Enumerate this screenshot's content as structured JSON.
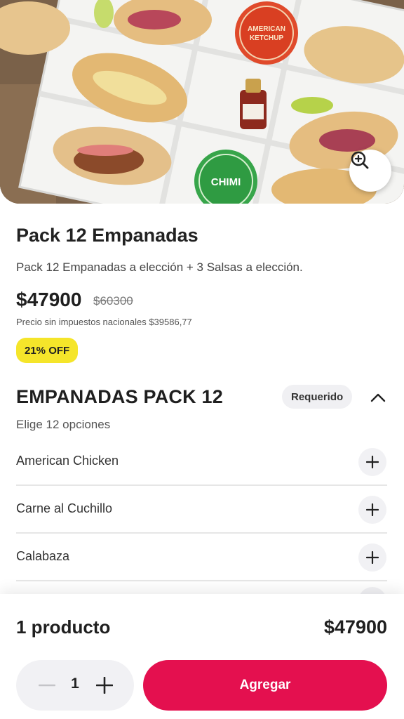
{
  "hero": {
    "image_alt": "Caja con 12 empanadas y salsas",
    "sauce_ketchup": "AMERICAN KETCHUP",
    "sauce_chimi": "CHIMI",
    "zoom_icon": "zoom-in-icon"
  },
  "product": {
    "title": "Pack 12 Empanadas",
    "description": "Pack 12 Empanadas a elección + 3 Salsas a elección.",
    "price": "$47900",
    "old_price": "$60300",
    "tax_note": "Precio sin impuestos nacionales $39586,77",
    "discount_badge": "21% OFF"
  },
  "section": {
    "title": "EMPANADAS PACK 12",
    "required_badge": "Requerido",
    "subtitle": "Elige 12 opciones",
    "options": [
      {
        "label": "American Chicken"
      },
      {
        "label": "Carne al Cuchillo"
      },
      {
        "label": "Calabaza"
      }
    ]
  },
  "footer": {
    "count_label": "1 producto",
    "total": "$47900",
    "quantity": "1",
    "add_button": "Agregar"
  },
  "colors": {
    "accent": "#e4104f",
    "badge_yellow": "#f5e52a",
    "chip_bg": "#f0f0f3"
  }
}
